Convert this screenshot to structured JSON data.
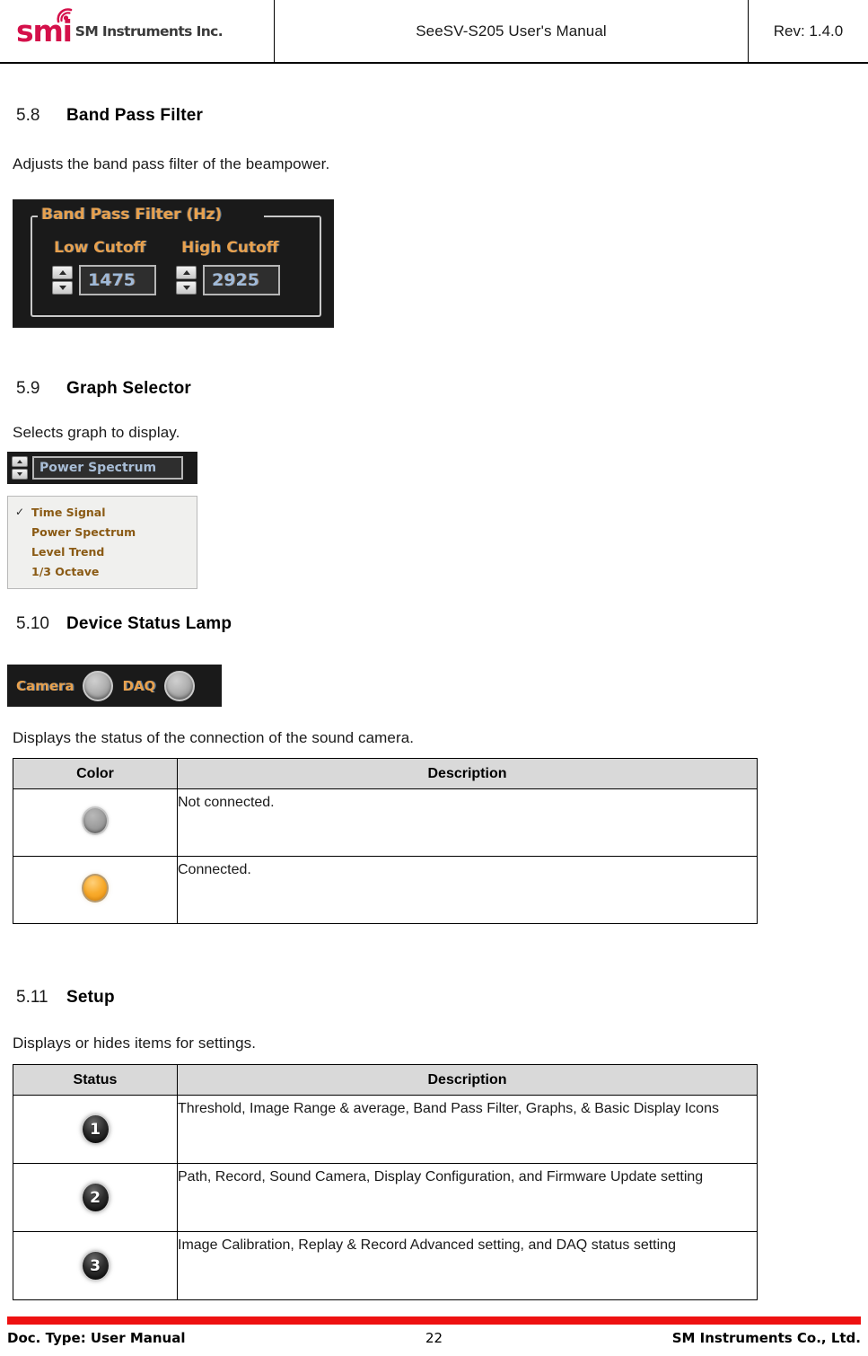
{
  "header": {
    "logo_mark": "smi",
    "logo_company": "SM Instruments Inc.",
    "title": "SeeSV-S205 User's Manual",
    "revision": "Rev: 1.4.0"
  },
  "sections": {
    "band_pass_filter": {
      "number": "5.8",
      "title": "Band Pass Filter",
      "body": "Adjusts the band pass filter of the beampower.",
      "panel": {
        "legend": "Band Pass Filter (Hz)",
        "low_label": "Low Cutoff",
        "high_label": "High Cutoff",
        "low_value": "1475",
        "high_value": "2925"
      }
    },
    "graph_selector": {
      "number": "5.9",
      "title": "Graph Selector",
      "body": "Selects graph to display.",
      "combo_value": "Power Spectrum",
      "menu_items": [
        {
          "label": "Time Signal",
          "checked": "✓"
        },
        {
          "label": "Power Spectrum",
          "checked": ""
        },
        {
          "label": "Level Trend",
          "checked": ""
        },
        {
          "label": "1/3 Octave",
          "checked": ""
        }
      ]
    },
    "device_status_lamp": {
      "number": "5.10",
      "title": "Device Status Lamp",
      "body": "Displays the status of the connection of the sound camera.",
      "panel": {
        "camera_label": "Camera",
        "daq_label": "DAQ"
      },
      "table": {
        "headers": [
          "Color",
          "Description"
        ],
        "rows": [
          {
            "icon": "led-gray",
            "description": "Not connected."
          },
          {
            "icon": "led-orange",
            "description": "Connected."
          }
        ]
      }
    },
    "setup": {
      "number": "5.11",
      "title": "Setup",
      "body": "Displays or hides items for settings.",
      "table": {
        "headers": [
          "Status",
          "Description"
        ],
        "rows": [
          {
            "badge": "1",
            "description": "Threshold, Image Range & average, Band Pass Filter, Graphs, & Basic Display Icons"
          },
          {
            "badge": "2",
            "description": "Path, Record, Sound Camera, Display Configuration, and Firmware Update setting"
          },
          {
            "badge": "3",
            "description": "Image Calibration, Replay & Record Advanced setting, and DAQ status setting"
          }
        ]
      }
    }
  },
  "footer": {
    "doc_type": "Doc. Type: User Manual",
    "page_number": "22",
    "company": "SM Instruments Co., Ltd."
  },
  "colors": {
    "brand_red": "#d4104a",
    "footer_bar_red": "#ee1111",
    "panel_bg": "#1a1a1a",
    "label_orange": "#e8a14e",
    "value_blue": "#9fb9d8",
    "menu_text": "#8a5a14",
    "table_header_bg": "#d9d9d9",
    "led_connected": "#f8ab2c",
    "led_not_connected": "#9e9e9e"
  }
}
